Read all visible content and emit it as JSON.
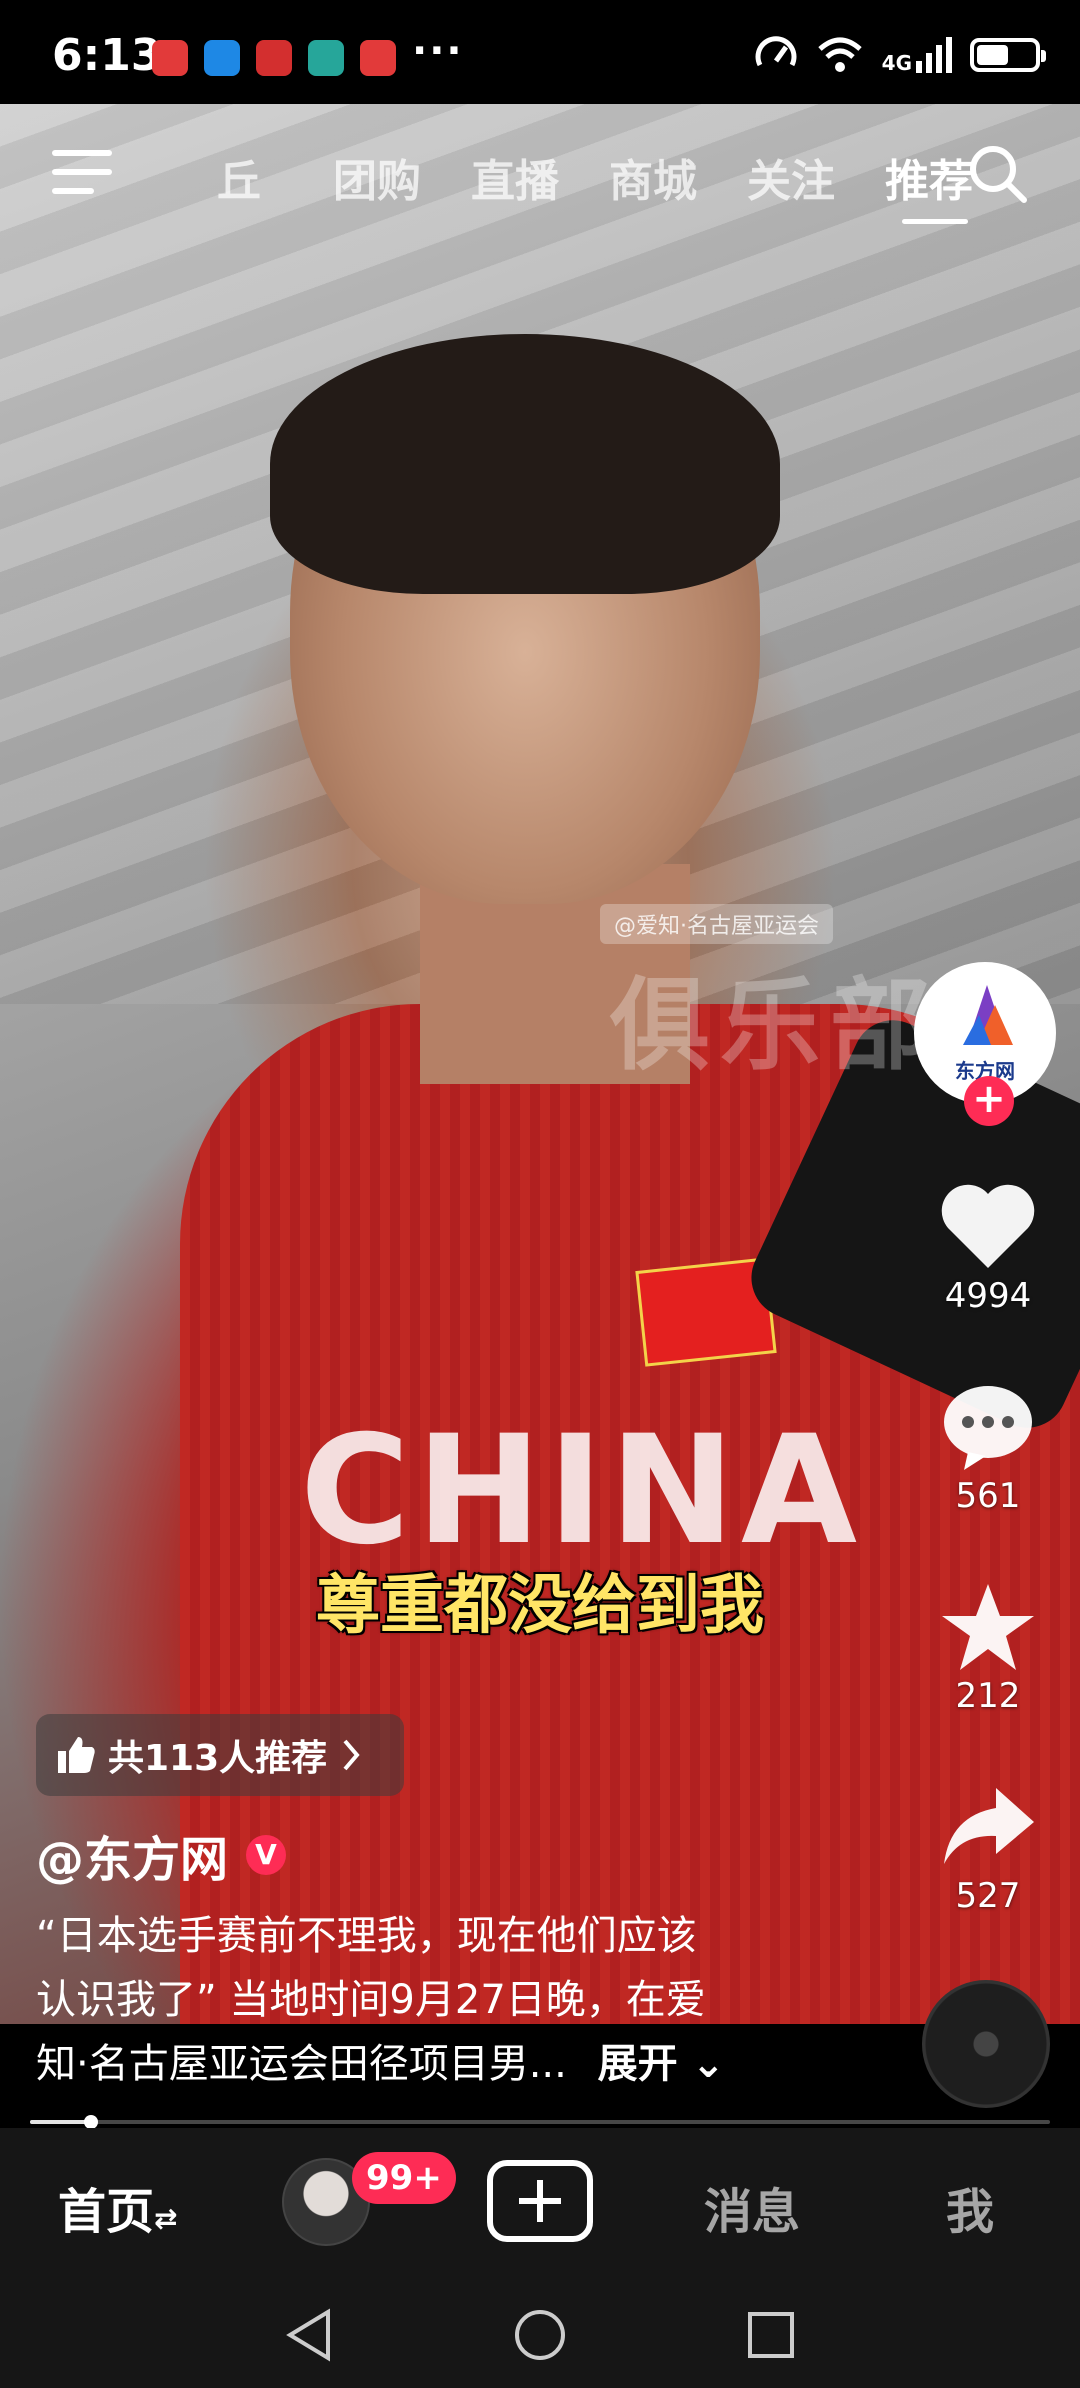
{
  "status_bar": {
    "time": "6:13",
    "notification_icons": [
      "huawei-store-icon",
      "message-icon",
      "bank-icon",
      "shield-icon",
      "huawei-store-icon"
    ],
    "more": "···",
    "network": "4G",
    "battery_level": 0.55
  },
  "top_nav": {
    "tabs": [
      {
        "label": "丘",
        "active": false
      },
      {
        "label": "团购",
        "active": false
      },
      {
        "label": "直播",
        "active": false
      },
      {
        "label": "商城",
        "active": false
      },
      {
        "label": "关注",
        "active": false
      },
      {
        "label": "推荐",
        "active": true
      }
    ]
  },
  "video": {
    "subtitle": "尊重都没给到我",
    "jersey_text": "CHINA",
    "watermark_small": "@爱知·名古屋亚运会",
    "watermark_big": "俱乐部"
  },
  "rail": {
    "creator_avatar_label": "东方网",
    "likes": "4994",
    "comments": "561",
    "favorites": "212",
    "shares": "527"
  },
  "recommend": {
    "label": "共113人推荐"
  },
  "post": {
    "author": "@东方网",
    "verified_badge": "V",
    "description_lines": [
      "“日本选手赛前不理我，现在他们应该",
      "认识我了” 当地时间9月27日晚，在爱",
      "知·名古屋亚运会田径项目男..."
    ],
    "expand_label": "展开"
  },
  "progress": 0.06,
  "tabbar": {
    "home": "首页",
    "home_switch": "⇄",
    "badge": "99+",
    "messages": "消息",
    "me": "我"
  },
  "colors": {
    "accent": "#fe2c55",
    "subtitle": "#ffe566"
  }
}
